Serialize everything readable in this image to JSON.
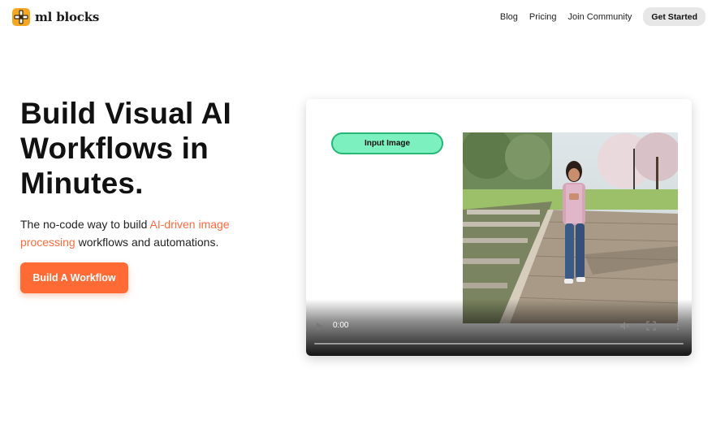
{
  "brand": {
    "name": "ml blocks"
  },
  "nav": {
    "links": [
      "Blog",
      "Pricing",
      "Join Community"
    ],
    "cta": "Get Started"
  },
  "hero": {
    "title": "Build Visual AI Workflows in Minutes.",
    "subtitle_pre": "The no-code way to build ",
    "subtitle_accent": "AI-driven image processing",
    "subtitle_post": " workflows and automations.",
    "cta": "Build A Workflow"
  },
  "video": {
    "node_label": "Input Image",
    "time": "0:00",
    "icons": [
      "play-icon",
      "mute-icon",
      "fullscreen-icon",
      "more-icon"
    ]
  },
  "colors": {
    "accent": "#ff6a35",
    "node_fill": "#7cf0bf",
    "node_border": "#26b676",
    "logo": "#f5a623"
  }
}
